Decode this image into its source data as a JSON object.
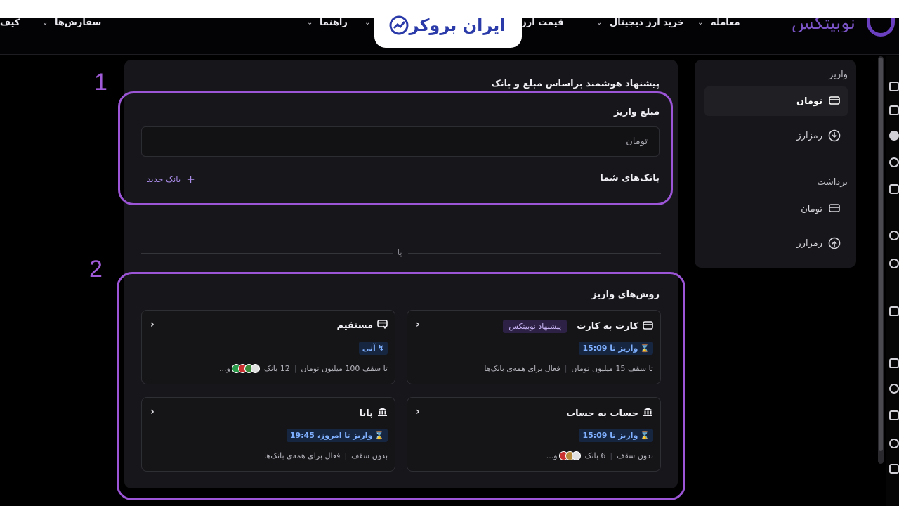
{
  "nav": {
    "items": [
      {
        "label": "معامله",
        "name": "nav-trade"
      },
      {
        "label": "خرید ارز دیجیتال",
        "name": "nav-buy-crypto"
      },
      {
        "label": "قیمت ارز دیجیتال",
        "name": "nav-crypto-price"
      },
      {
        "label": "راهنما",
        "name": "nav-help"
      },
      {
        "label": "سفارش‌ها",
        "name": "nav-orders"
      },
      {
        "label": "کیف",
        "name": "nav-wallet"
      }
    ],
    "logo_text": "نوبیتکس"
  },
  "brand_badge": "ایران بروکر",
  "sidebar": {
    "deposit_heading": "واریز",
    "withdraw_heading": "برداشت",
    "deposit_items": [
      {
        "label": "تومان",
        "icon": "bank-card-icon",
        "active": true
      },
      {
        "label": "رمزارز",
        "icon": "arrow-down-circle-icon",
        "active": false
      }
    ],
    "withdraw_items": [
      {
        "label": "تومان",
        "icon": "bank-card-icon",
        "active": false
      },
      {
        "label": "رمزارز",
        "icon": "arrow-up-circle-icon",
        "active": false
      }
    ]
  },
  "main": {
    "smart_title": "پیشنهاد هوشمند براساس مبلغ و بانک",
    "amount_label": "مبلغ واریز",
    "amount_placeholder": "تومان",
    "banks_label": "بانک‌های شما",
    "new_bank": "بانک جدید",
    "or_text": "یا",
    "methods_title": "روش‌های واریز",
    "methods": [
      {
        "title": "کارت به کارت",
        "icon": "card-icon",
        "suggest": "پیشنهاد نوبیتکس",
        "badge": "واریز تا 15:09",
        "limit": "تا سقف 15 میلیون تومان",
        "banks": "فعال برای همه‌ی بانک‌ها"
      },
      {
        "title": "مستقیم",
        "icon": "direct-icon",
        "badge": "آنی",
        "limit": "تا سقف 100 میلیون تومان",
        "banks": "12 بانک",
        "more": "و..."
      },
      {
        "title": "حساب به حساب",
        "icon": "bank-building-icon",
        "badge": "واریز تا 15:09",
        "limit": "بدون سقف",
        "banks": "6 بانک",
        "more": "و..."
      },
      {
        "title": "پایا",
        "icon": "bank-building-icon",
        "badge": "واریز تا امروز، 19:45",
        "limit": "بدون سقف",
        "banks": "فعال برای همه‌ی بانک‌ها"
      }
    ]
  },
  "annotations": {
    "one": "1",
    "two": "2"
  },
  "colors": {
    "accent": "#9b55d6",
    "panel": "#17171b",
    "badge_blue": "#7fb0ff",
    "suggest_bg": "#2d2245"
  }
}
